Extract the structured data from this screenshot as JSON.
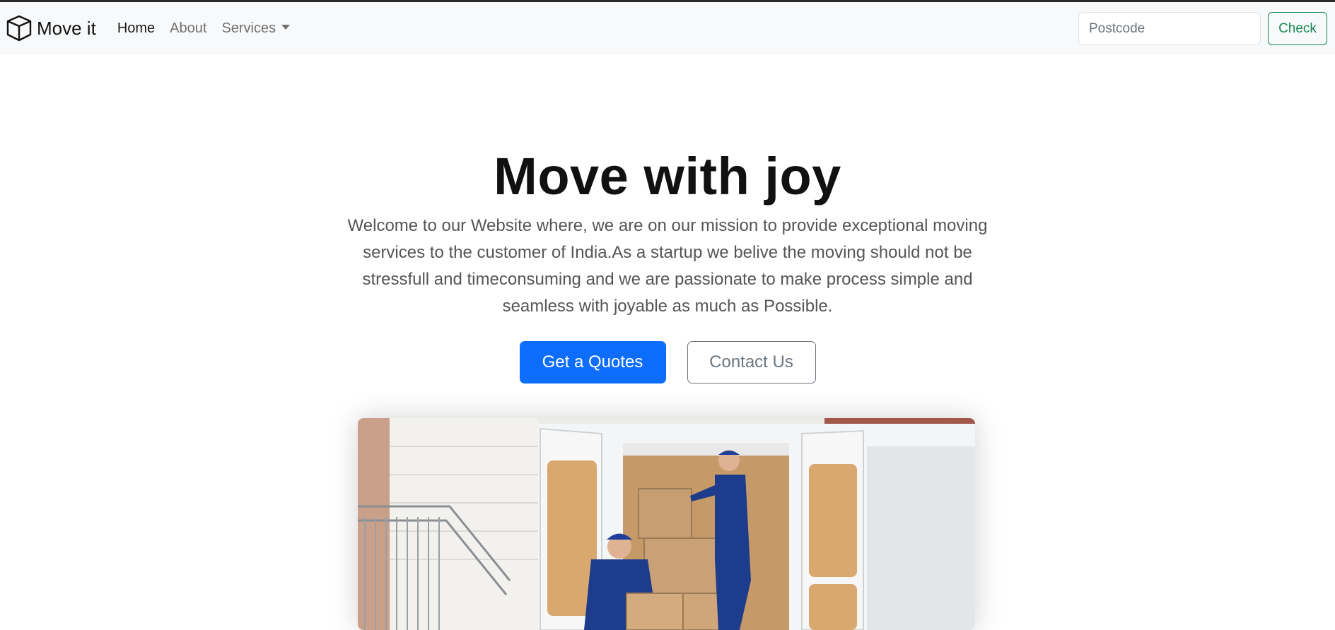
{
  "navbar": {
    "brand": "Move it",
    "brand_icon": "box-icon",
    "links": [
      {
        "label": "Home"
      },
      {
        "label": "About"
      },
      {
        "label": "Services"
      }
    ],
    "search": {
      "placeholder": "Postcode",
      "value": ""
    },
    "check_label": "Check"
  },
  "hero": {
    "title": "Move with joy",
    "lead": "Welcome to our Website where, we are on our mission to provide exceptional moving services to the customer of India.As a startup we belive the moving should not be stressfull and timeconsuming and we are passionate to make process simple and seamless with joyable as much as Possible.",
    "primary_button": "Get a Quotes",
    "secondary_button": "Contact Us"
  },
  "colors": {
    "primary": "#0d6efd",
    "success": "#198754",
    "navbar_bg": "#f8f9fa"
  }
}
